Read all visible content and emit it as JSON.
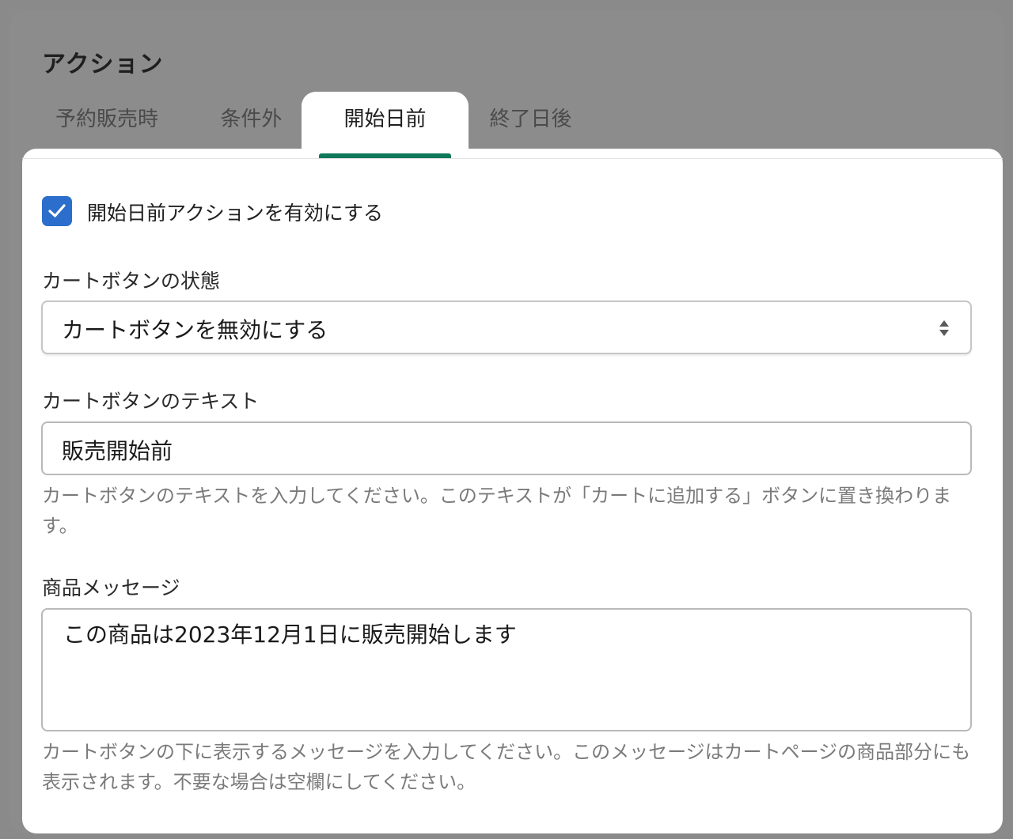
{
  "section": {
    "title": "アクション"
  },
  "tabs": [
    {
      "label": "予約販売時"
    },
    {
      "label": "条件外"
    },
    {
      "label": "開始日前",
      "active": true
    },
    {
      "label": "終了日後"
    }
  ],
  "enable_checkbox": {
    "label": "開始日前アクションを有効にする",
    "checked": true
  },
  "cart_button_state": {
    "label": "カートボタンの状態",
    "selected": "カートボタンを無効にする"
  },
  "cart_button_text": {
    "label": "カートボタンのテキスト",
    "value": "販売開始前",
    "help": "カートボタンのテキストを入力してください。このテキストが「カートに追加する」ボタンに置き換わります。"
  },
  "product_message": {
    "label": "商品メッセージ",
    "value": "この商品は2023年12月1日に販売開始します",
    "help": "カートボタンの下に表示するメッセージを入力してください。このメッセージはカートページの商品部分にも表示されます。不要な場合は空欄にしてください。"
  },
  "colors": {
    "accent_green": "#0f7a5a",
    "checkbox_blue": "#2c6ecb",
    "overlay_gray": "#8a8a8a"
  }
}
